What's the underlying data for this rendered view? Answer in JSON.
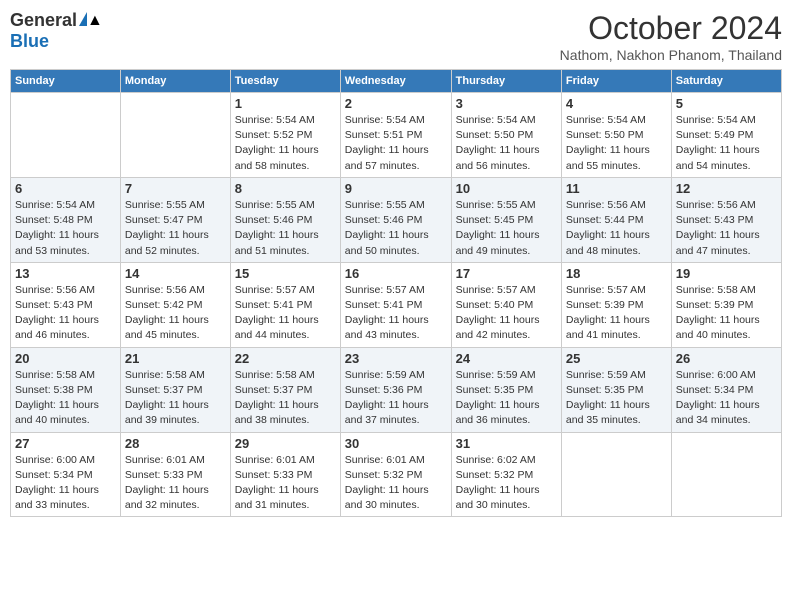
{
  "header": {
    "logo_general": "General",
    "logo_blue": "Blue",
    "month": "October 2024",
    "location": "Nathom, Nakhon Phanom, Thailand"
  },
  "weekdays": [
    "Sunday",
    "Monday",
    "Tuesday",
    "Wednesday",
    "Thursday",
    "Friday",
    "Saturday"
  ],
  "weeks": [
    [
      {
        "day": null,
        "info": null
      },
      {
        "day": null,
        "info": null
      },
      {
        "day": "1",
        "info": "Sunrise: 5:54 AM\nSunset: 5:52 PM\nDaylight: 11 hours and 58 minutes."
      },
      {
        "day": "2",
        "info": "Sunrise: 5:54 AM\nSunset: 5:51 PM\nDaylight: 11 hours and 57 minutes."
      },
      {
        "day": "3",
        "info": "Sunrise: 5:54 AM\nSunset: 5:50 PM\nDaylight: 11 hours and 56 minutes."
      },
      {
        "day": "4",
        "info": "Sunrise: 5:54 AM\nSunset: 5:50 PM\nDaylight: 11 hours and 55 minutes."
      },
      {
        "day": "5",
        "info": "Sunrise: 5:54 AM\nSunset: 5:49 PM\nDaylight: 11 hours and 54 minutes."
      }
    ],
    [
      {
        "day": "6",
        "info": "Sunrise: 5:54 AM\nSunset: 5:48 PM\nDaylight: 11 hours and 53 minutes."
      },
      {
        "day": "7",
        "info": "Sunrise: 5:55 AM\nSunset: 5:47 PM\nDaylight: 11 hours and 52 minutes."
      },
      {
        "day": "8",
        "info": "Sunrise: 5:55 AM\nSunset: 5:46 PM\nDaylight: 11 hours and 51 minutes."
      },
      {
        "day": "9",
        "info": "Sunrise: 5:55 AM\nSunset: 5:46 PM\nDaylight: 11 hours and 50 minutes."
      },
      {
        "day": "10",
        "info": "Sunrise: 5:55 AM\nSunset: 5:45 PM\nDaylight: 11 hours and 49 minutes."
      },
      {
        "day": "11",
        "info": "Sunrise: 5:56 AM\nSunset: 5:44 PM\nDaylight: 11 hours and 48 minutes."
      },
      {
        "day": "12",
        "info": "Sunrise: 5:56 AM\nSunset: 5:43 PM\nDaylight: 11 hours and 47 minutes."
      }
    ],
    [
      {
        "day": "13",
        "info": "Sunrise: 5:56 AM\nSunset: 5:43 PM\nDaylight: 11 hours and 46 minutes."
      },
      {
        "day": "14",
        "info": "Sunrise: 5:56 AM\nSunset: 5:42 PM\nDaylight: 11 hours and 45 minutes."
      },
      {
        "day": "15",
        "info": "Sunrise: 5:57 AM\nSunset: 5:41 PM\nDaylight: 11 hours and 44 minutes."
      },
      {
        "day": "16",
        "info": "Sunrise: 5:57 AM\nSunset: 5:41 PM\nDaylight: 11 hours and 43 minutes."
      },
      {
        "day": "17",
        "info": "Sunrise: 5:57 AM\nSunset: 5:40 PM\nDaylight: 11 hours and 42 minutes."
      },
      {
        "day": "18",
        "info": "Sunrise: 5:57 AM\nSunset: 5:39 PM\nDaylight: 11 hours and 41 minutes."
      },
      {
        "day": "19",
        "info": "Sunrise: 5:58 AM\nSunset: 5:39 PM\nDaylight: 11 hours and 40 minutes."
      }
    ],
    [
      {
        "day": "20",
        "info": "Sunrise: 5:58 AM\nSunset: 5:38 PM\nDaylight: 11 hours and 40 minutes."
      },
      {
        "day": "21",
        "info": "Sunrise: 5:58 AM\nSunset: 5:37 PM\nDaylight: 11 hours and 39 minutes."
      },
      {
        "day": "22",
        "info": "Sunrise: 5:58 AM\nSunset: 5:37 PM\nDaylight: 11 hours and 38 minutes."
      },
      {
        "day": "23",
        "info": "Sunrise: 5:59 AM\nSunset: 5:36 PM\nDaylight: 11 hours and 37 minutes."
      },
      {
        "day": "24",
        "info": "Sunrise: 5:59 AM\nSunset: 5:35 PM\nDaylight: 11 hours and 36 minutes."
      },
      {
        "day": "25",
        "info": "Sunrise: 5:59 AM\nSunset: 5:35 PM\nDaylight: 11 hours and 35 minutes."
      },
      {
        "day": "26",
        "info": "Sunrise: 6:00 AM\nSunset: 5:34 PM\nDaylight: 11 hours and 34 minutes."
      }
    ],
    [
      {
        "day": "27",
        "info": "Sunrise: 6:00 AM\nSunset: 5:34 PM\nDaylight: 11 hours and 33 minutes."
      },
      {
        "day": "28",
        "info": "Sunrise: 6:01 AM\nSunset: 5:33 PM\nDaylight: 11 hours and 32 minutes."
      },
      {
        "day": "29",
        "info": "Sunrise: 6:01 AM\nSunset: 5:33 PM\nDaylight: 11 hours and 31 minutes."
      },
      {
        "day": "30",
        "info": "Sunrise: 6:01 AM\nSunset: 5:32 PM\nDaylight: 11 hours and 30 minutes."
      },
      {
        "day": "31",
        "info": "Sunrise: 6:02 AM\nSunset: 5:32 PM\nDaylight: 11 hours and 30 minutes."
      },
      {
        "day": null,
        "info": null
      },
      {
        "day": null,
        "info": null
      }
    ]
  ]
}
